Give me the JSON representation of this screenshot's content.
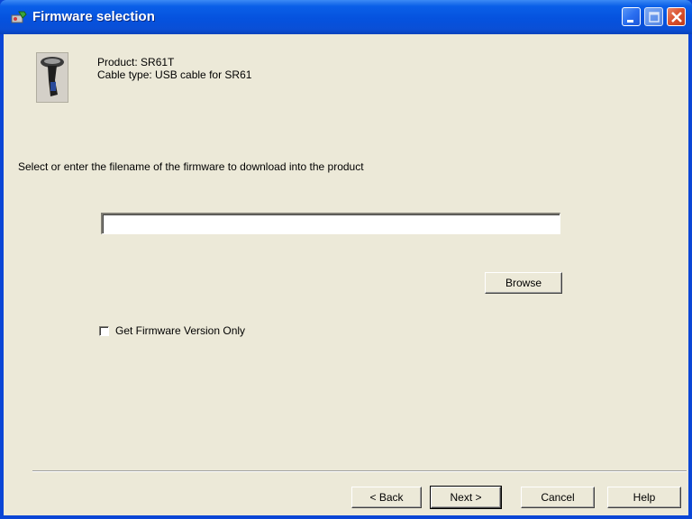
{
  "window": {
    "title": "Firmware selection",
    "icon": "wrench-app-icon",
    "controls": [
      "minimize",
      "maximize",
      "close"
    ]
  },
  "product": {
    "icon": "barcode-scanner-icon",
    "product_line": "Product:  SR61T",
    "cable_line": "Cable type:  USB cable for SR61"
  },
  "instruction": "Select or enter the filename of the firmware to download into the product",
  "firmware_input": {
    "value": "",
    "placeholder": ""
  },
  "browse_label": "Browse",
  "checkbox": {
    "label": "Get Firmware Version Only",
    "checked": false
  },
  "buttons": {
    "back": "< Back",
    "next": "Next >",
    "cancel": "Cancel",
    "help": "Help"
  }
}
